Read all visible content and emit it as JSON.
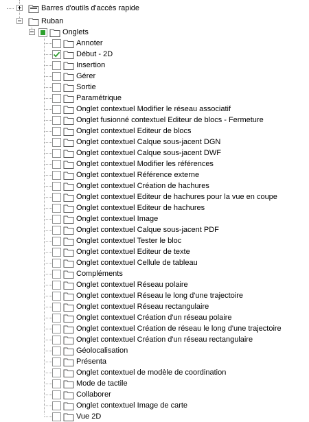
{
  "tree": {
    "root_items": [
      {
        "label": "Barres d'outils d'accès rapide",
        "expander": "+",
        "icon": "toolbar-folder-icon"
      },
      {
        "label": "Ruban",
        "expander": "-",
        "icon": "folder-icon"
      }
    ],
    "ribbon": {
      "tabs_node": {
        "label": "Onglets",
        "expander": "-",
        "state": "partial"
      },
      "tabs": [
        {
          "label": "Annoter",
          "checked": false
        },
        {
          "label": "Début - 2D",
          "checked": true
        },
        {
          "label": "Insertion",
          "checked": false
        },
        {
          "label": "Gérer",
          "checked": false
        },
        {
          "label": "Sortie",
          "checked": false
        },
        {
          "label": "Paramétrique",
          "checked": false
        },
        {
          "label": "Onglet contextuel Modifier le réseau associatif",
          "checked": false
        },
        {
          "label": "Onglet fusionné contextuel Editeur de blocs - Fermeture",
          "checked": false
        },
        {
          "label": "Onglet contextuel Editeur de blocs",
          "checked": false
        },
        {
          "label": "Onglet contextuel Calque sous-jacent DGN",
          "checked": false
        },
        {
          "label": "Onglet contextuel Calque sous-jacent DWF",
          "checked": false
        },
        {
          "label": "Onglet contextuel Modifier les références",
          "checked": false
        },
        {
          "label": "Onglet contextuel Référence externe",
          "checked": false
        },
        {
          "label": "Onglet contextuel Création de hachures",
          "checked": false
        },
        {
          "label": "Onglet contextuel Editeur de hachures pour la vue en coupe",
          "checked": false
        },
        {
          "label": "Onglet contextuel Editeur de hachures",
          "checked": false
        },
        {
          "label": "Onglet contextuel Image",
          "checked": false
        },
        {
          "label": "Onglet contextuel Calque sous-jacent PDF",
          "checked": false
        },
        {
          "label": "Onglet contextuel Tester le bloc",
          "checked": false
        },
        {
          "label": "Onglet contextuel Editeur de texte",
          "checked": false
        },
        {
          "label": "Onglet contextuel Cellule de tableau",
          "checked": false
        },
        {
          "label": "Compléments",
          "checked": false
        },
        {
          "label": "Onglet contextuel Réseau polaire",
          "checked": false
        },
        {
          "label": "Onglet contextuel Réseau le long d'une trajectoire",
          "checked": false
        },
        {
          "label": "Onglet contextuel Réseau rectangulaire",
          "checked": false
        },
        {
          "label": "Onglet contextuel Création d'un réseau polaire",
          "checked": false
        },
        {
          "label": "Onglet contextuel Création de réseau le long d'une trajectoire",
          "checked": false
        },
        {
          "label": "Onglet contextuel Création d'un réseau rectangulaire",
          "checked": false
        },
        {
          "label": "Géolocalisation",
          "checked": false
        },
        {
          "label": "Présenta",
          "checked": false
        },
        {
          "label": "Onglet contextuel de modèle de coordination",
          "checked": false
        },
        {
          "label": "Mode de tactile",
          "checked": false
        },
        {
          "label": "Collaborer",
          "checked": false
        },
        {
          "label": "Onglet contextuel Image de carte",
          "checked": false
        },
        {
          "label": "Vue 2D",
          "checked": false
        }
      ]
    }
  },
  "colors": {
    "check": "#2b9a2b",
    "partial": "#2da02d",
    "folder": "#5a5a5a"
  }
}
